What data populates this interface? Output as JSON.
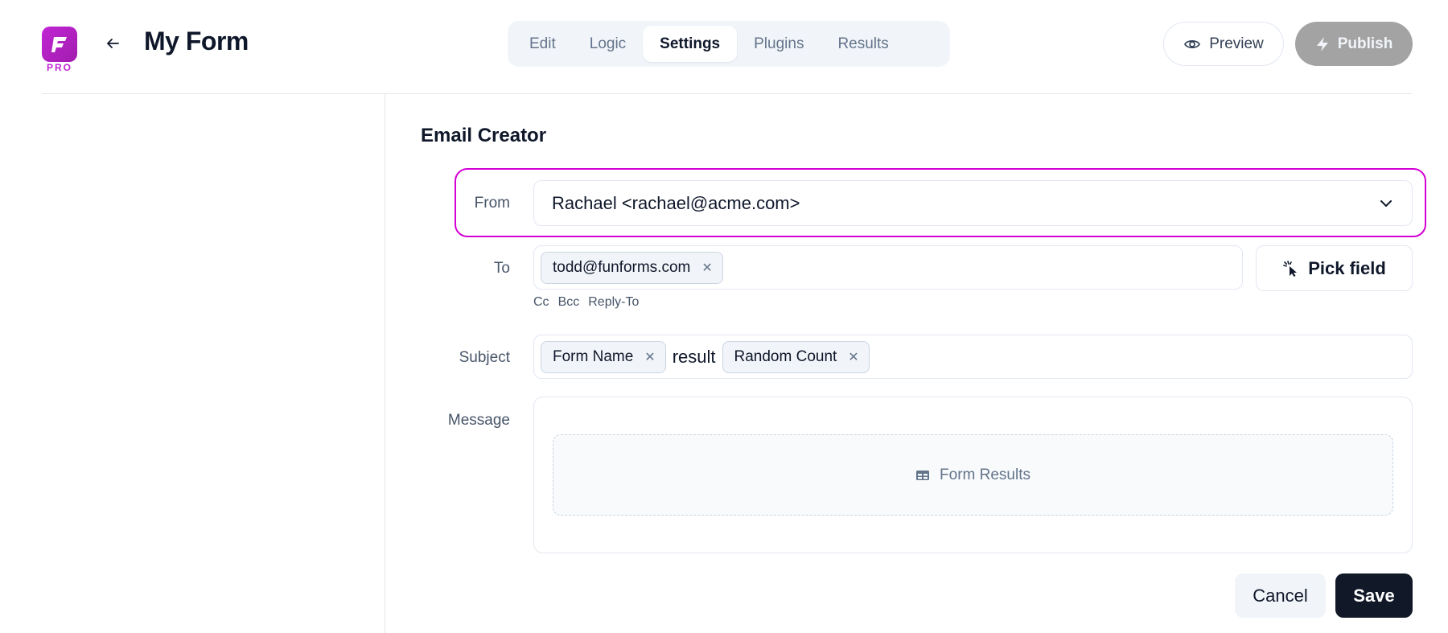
{
  "app": {
    "badge": "PRO",
    "form_title": "My Form",
    "brand_color": "#c026d3"
  },
  "tabs": [
    {
      "label": "Edit",
      "active": false
    },
    {
      "label": "Logic",
      "active": false
    },
    {
      "label": "Settings",
      "active": true
    },
    {
      "label": "Plugins",
      "active": false
    },
    {
      "label": "Results",
      "active": false
    }
  ],
  "header_actions": {
    "preview_label": "Preview",
    "publish_label": "Publish"
  },
  "icons": {
    "logo": "app-logo-icon",
    "back": "arrow-left-icon",
    "preview": "eye-icon",
    "publish": "lightning-icon",
    "chevron": "chevron-down-icon",
    "pick": "pointer-click-icon",
    "results": "table-icon",
    "remove": "close-icon"
  },
  "email_creator": {
    "title": "Email Creator",
    "from": {
      "label": "From",
      "value": "Rachael <rachael@acme.com>",
      "highlight_color": "#d400d4"
    },
    "to": {
      "label": "To",
      "chips": [
        "todd@funforms.com"
      ],
      "pick_field_label": "Pick field",
      "links": [
        "Cc",
        "Bcc",
        "Reply-To"
      ]
    },
    "subject": {
      "label": "Subject",
      "chip_1": "Form Name",
      "text": "result",
      "chip_2": "Random Count"
    },
    "message": {
      "label": "Message",
      "block_label": "Form Results"
    }
  },
  "footer": {
    "cancel_label": "Cancel",
    "save_label": "Save"
  }
}
